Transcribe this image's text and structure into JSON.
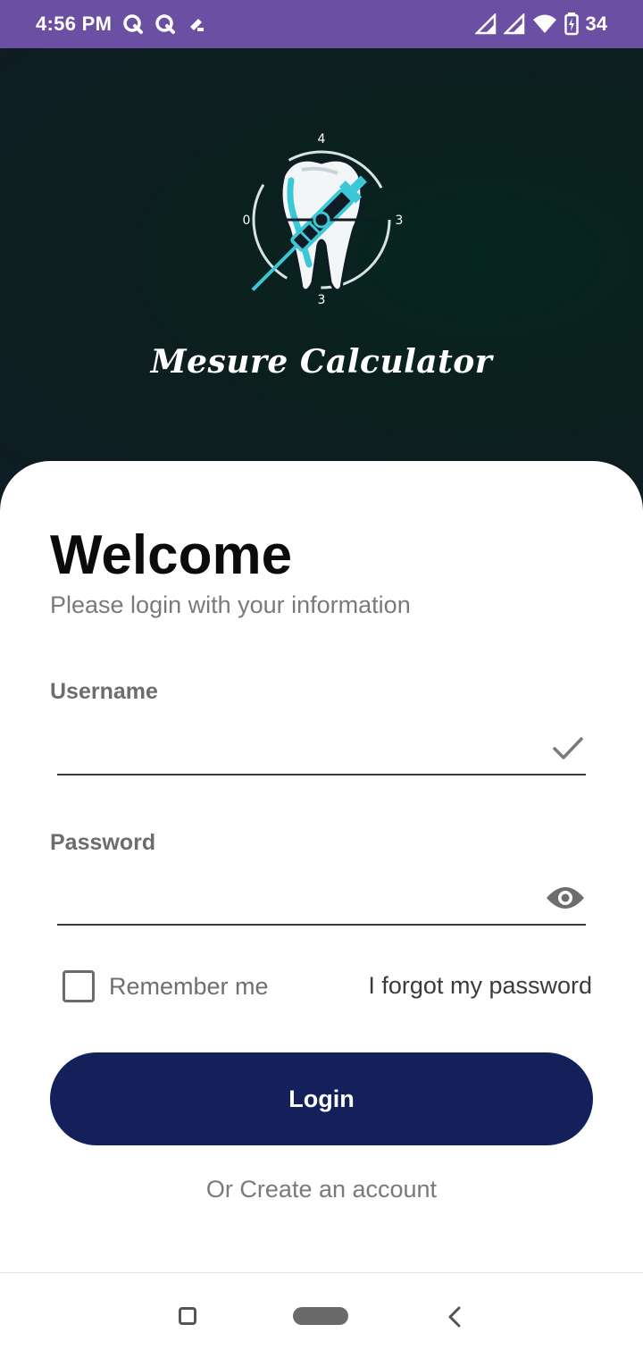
{
  "status_bar": {
    "time": "4:56 PM",
    "notification_icons": [
      "q-app-icon",
      "q-app-icon",
      "pen-app-icon"
    ],
    "right_icons": [
      "signal-icon",
      "signal-icon",
      "wifi-icon",
      "battery-icon"
    ],
    "battery": "34",
    "background_color": "#6a4fa3"
  },
  "header": {
    "logo_icon": "tooth-syringe-logo-icon",
    "logo_marks": {
      "top": "4",
      "left": "0",
      "right": "3",
      "bottom": "3"
    },
    "app_title": "Mesure Calculator"
  },
  "login": {
    "title": "Welcome",
    "subtitle": "Please login with your information",
    "username": {
      "label": "Username",
      "value": "",
      "trailing_icon": "check-icon"
    },
    "password": {
      "label": "Password",
      "value": "",
      "trailing_icon": "eye-icon"
    },
    "remember_me": {
      "label": "Remember me",
      "checked": false
    },
    "forgot_password": "I forgot my password",
    "login_button": "Login",
    "create_account": "Or Create an account",
    "accent_color": "#13205a"
  },
  "nav_bar": {
    "icons": [
      "recents-icon",
      "home-icon",
      "back-icon"
    ]
  }
}
